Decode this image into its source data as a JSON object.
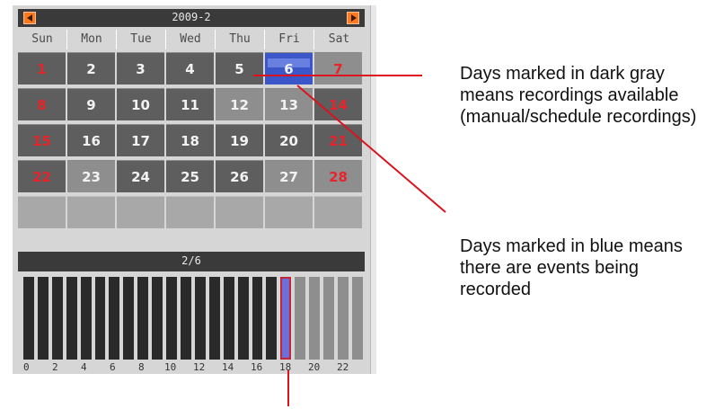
{
  "calendar": {
    "month_label": "2009-2",
    "weekdays": [
      "Sun",
      "Mon",
      "Tue",
      "Wed",
      "Thu",
      "Fri",
      "Sat"
    ],
    "weeks": [
      [
        "1",
        "2",
        "3",
        "4",
        "5",
        "6",
        "7"
      ],
      [
        "8",
        "9",
        "10",
        "11",
        "12",
        "13",
        "14"
      ],
      [
        "15",
        "16",
        "17",
        "18",
        "19",
        "20",
        "21"
      ],
      [
        "22",
        "23",
        "24",
        "25",
        "26",
        "27",
        "28"
      ],
      [
        "",
        "",
        "",
        "",
        "",
        "",
        ""
      ]
    ],
    "selected_date": "2/6"
  },
  "timeline": {
    "hour_labels": [
      "0",
      "2",
      "4",
      "6",
      "8",
      "10",
      "12",
      "14",
      "16",
      "18",
      "20",
      "22"
    ]
  },
  "annotations": {
    "dark_gray_note": "Days marked in dark gray means recordings available (manual/schedule recordings)",
    "blue_note": "Days marked in blue means there are events being recorded"
  },
  "colors": {
    "recorded_day": "#5e5e5e",
    "event_day": "#3b56c8",
    "weekend_text": "#e8232a",
    "leader_line": "#d9141e"
  }
}
